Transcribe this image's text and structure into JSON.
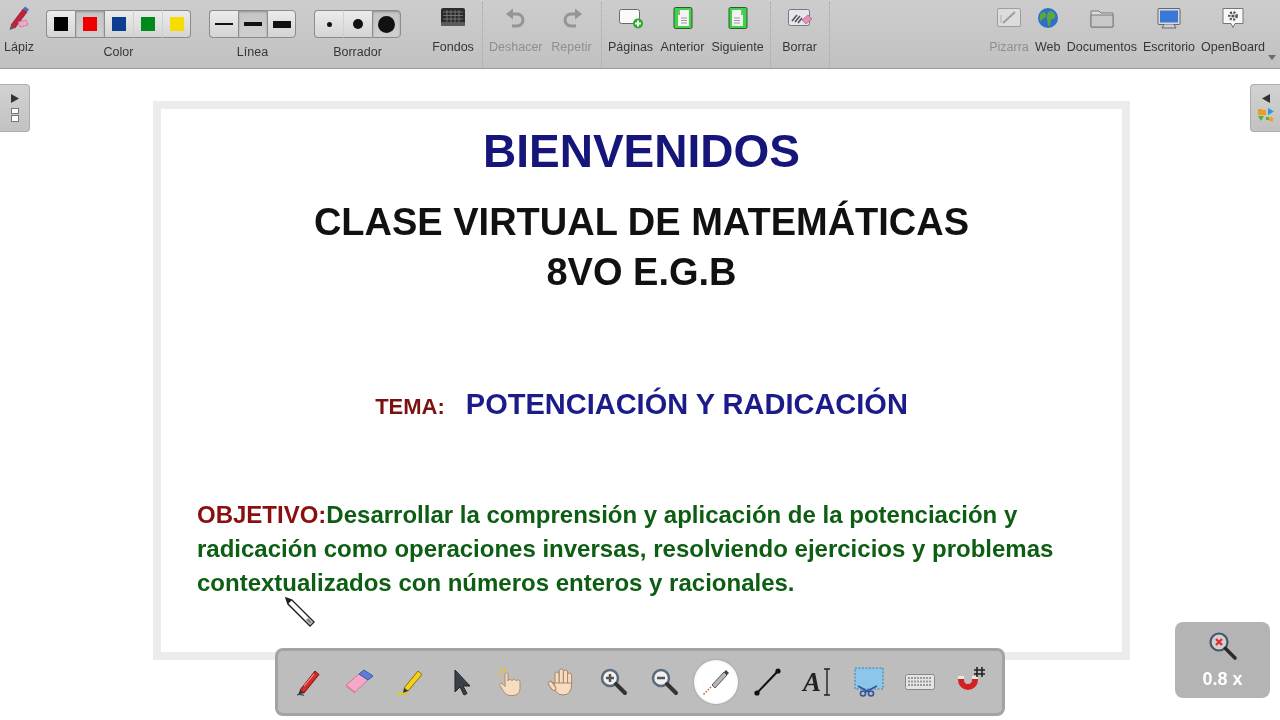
{
  "top_toolbar": {
    "pen": {
      "label": "Lápiz"
    },
    "color": {
      "label": "Color",
      "swatches": [
        {
          "color": "#000000",
          "selected": false
        },
        {
          "color": "#ee0000",
          "selected": true
        },
        {
          "color": "#0b3d91",
          "selected": false
        },
        {
          "color": "#008a1e",
          "selected": false
        },
        {
          "color": "#f7dc00",
          "selected": false
        }
      ]
    },
    "line": {
      "label": "Línea",
      "options": [
        {
          "selected": false
        },
        {
          "selected": true
        },
        {
          "selected": false
        }
      ]
    },
    "eraser": {
      "label": "Borrador",
      "options": [
        {
          "selected": false
        },
        {
          "selected": false
        },
        {
          "selected": true
        }
      ]
    },
    "action_groups": [
      {
        "items": [
          {
            "kind": "backgrounds",
            "label": "Fondos",
            "disabled": false
          }
        ]
      },
      {
        "items": [
          {
            "kind": "undo",
            "label": "Deshacer",
            "disabled": true
          },
          {
            "kind": "redo",
            "label": "Repetir",
            "disabled": true
          }
        ]
      },
      {
        "items": [
          {
            "kind": "add-page",
            "label": "Páginas",
            "disabled": false
          },
          {
            "kind": "previous",
            "label": "Anterior",
            "disabled": false
          },
          {
            "kind": "next",
            "label": "Siguiente",
            "disabled": false
          }
        ]
      },
      {
        "items": [
          {
            "kind": "clear",
            "label": "Borrar",
            "disabled": false
          }
        ]
      }
    ],
    "modes": [
      {
        "kind": "board",
        "label": "Pizarra",
        "selected": true
      },
      {
        "kind": "web",
        "label": "Web",
        "selected": false
      },
      {
        "kind": "documents",
        "label": "Documentos",
        "selected": false
      },
      {
        "kind": "desktop",
        "label": "Escritorio",
        "selected": false
      },
      {
        "kind": "app",
        "label": "OpenBoard",
        "selected": false
      }
    ]
  },
  "page": {
    "title": "BIENVENIDOS",
    "subtitle_lines": [
      "CLASE VIRTUAL DE MATEMÁTICAS",
      "8VO E.G.B"
    ],
    "topic": {
      "label": "TEMA:",
      "title": "POTENCIACIÓN Y RADICACIÓN"
    },
    "objective": {
      "label": "OBJETIVO:",
      "text": "Desarrollar la comprensión y aplicación de la potenciación y radicación como operaciones inversas, resolviendo ejercicios y problemas contextualizados con números enteros y racionales."
    }
  },
  "stylus_tools": [
    {
      "kind": "pen",
      "selected": false
    },
    {
      "kind": "eraser",
      "selected": false
    },
    {
      "kind": "marker",
      "selected": false
    },
    {
      "kind": "selector",
      "selected": false
    },
    {
      "kind": "play",
      "selected": false
    },
    {
      "kind": "hand",
      "selected": false
    },
    {
      "kind": "zoom-in",
      "selected": false
    },
    {
      "kind": "zoom-out",
      "selected": false
    },
    {
      "kind": "laser",
      "selected": true
    },
    {
      "kind": "line",
      "selected": false
    },
    {
      "kind": "text",
      "glyph": "A",
      "selected": false
    },
    {
      "kind": "capture",
      "selected": false
    },
    {
      "kind": "keyboard",
      "selected": false
    },
    {
      "kind": "magnet",
      "selected": false
    }
  ],
  "zoom": {
    "reading": "0.8 x"
  }
}
